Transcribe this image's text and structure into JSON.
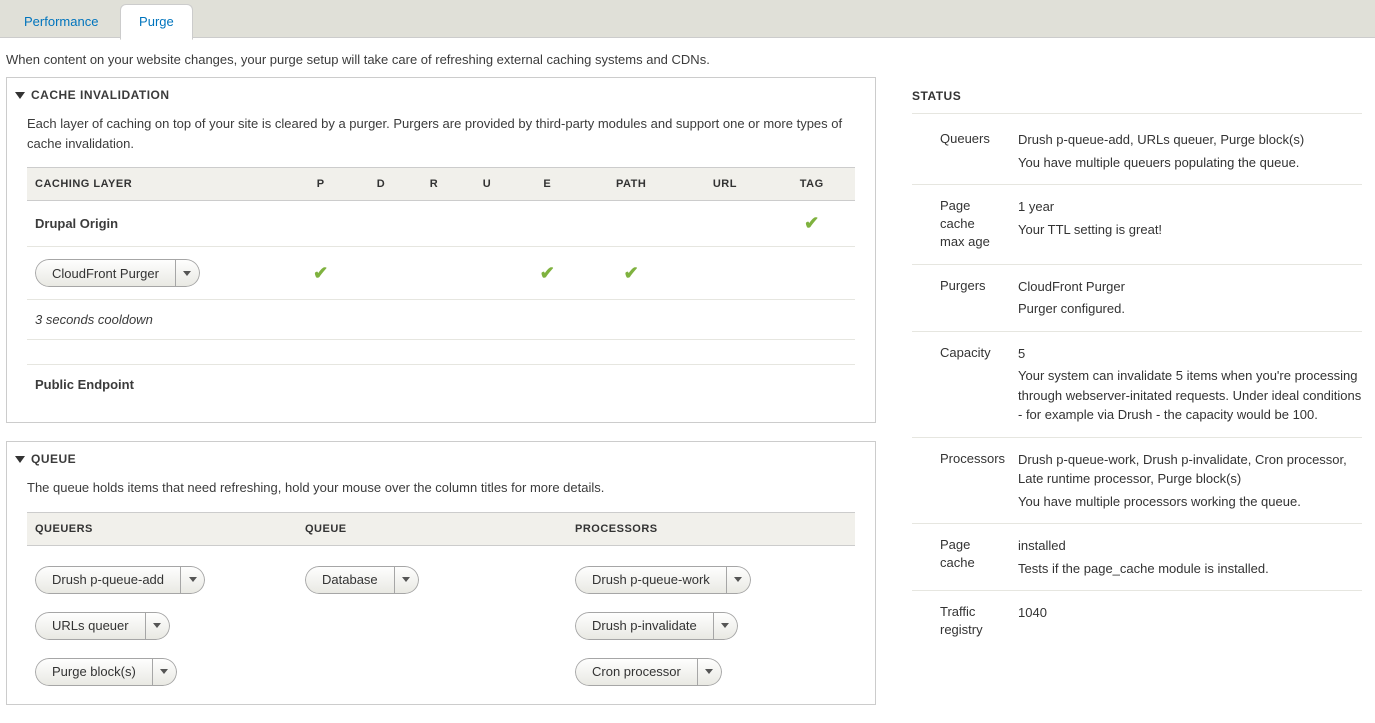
{
  "tabs": {
    "performance": "Performance",
    "purge": "Purge"
  },
  "intro": "When content on your website changes, your purge setup will take care of refreshing external caching systems and CDNs.",
  "cacheInvalidation": {
    "title": "CACHE INVALIDATION",
    "desc": "Each layer of caching on top of your site is cleared by a purger. Purgers are provided by third-party modules and support one or more types of cache invalidation.",
    "headers": [
      "CACHING LAYER",
      "P",
      "D",
      "R",
      "U",
      "E",
      "PATH",
      "URL",
      "TAG"
    ],
    "rows": {
      "drupal": "Drupal Origin",
      "cloudfront": "CloudFront Purger",
      "cooldown": "3 seconds cooldown",
      "public": "Public Endpoint"
    }
  },
  "queue": {
    "title": "QUEUE",
    "desc": "The queue holds items that need refreshing, hold your mouse over the column titles for more details.",
    "headers": {
      "queuers": "QUEUERS",
      "queue": "QUEUE",
      "processors": "PROCESSORS"
    },
    "queuers": [
      "Drush p-queue-add",
      "URLs queuer",
      "Purge block(s)"
    ],
    "queueBackend": "Database",
    "processors": [
      "Drush p-queue-work",
      "Drush p-invalidate",
      "Cron processor"
    ]
  },
  "status": {
    "title": "STATUS",
    "items": [
      {
        "label": "Queuers",
        "value": "Drush p-queue-add, URLs queuer, Purge block(s)",
        "sub": "You have multiple queuers populating the queue."
      },
      {
        "label": "Page cache max age",
        "value": "1 year",
        "sub": "Your TTL setting is great!"
      },
      {
        "label": "Purgers",
        "value": "CloudFront Purger",
        "sub": "Purger configured."
      },
      {
        "label": "Capacity",
        "value": "5",
        "sub": "Your system can invalidate 5 items when you're processing through webserver-initated requests. Under ideal conditions - for example via Drush - the capacity would be 100."
      },
      {
        "label": "Processors",
        "value": "Drush p-queue-work, Drush p-invalidate, Cron processor, Late runtime processor, Purge block(s)",
        "sub": "You have multiple processors working the queue."
      },
      {
        "label": "Page cache",
        "value": "installed",
        "sub": "Tests if the page_cache module is installed."
      },
      {
        "label": "Traffic registry",
        "value": "1040",
        "sub": ""
      }
    ]
  }
}
